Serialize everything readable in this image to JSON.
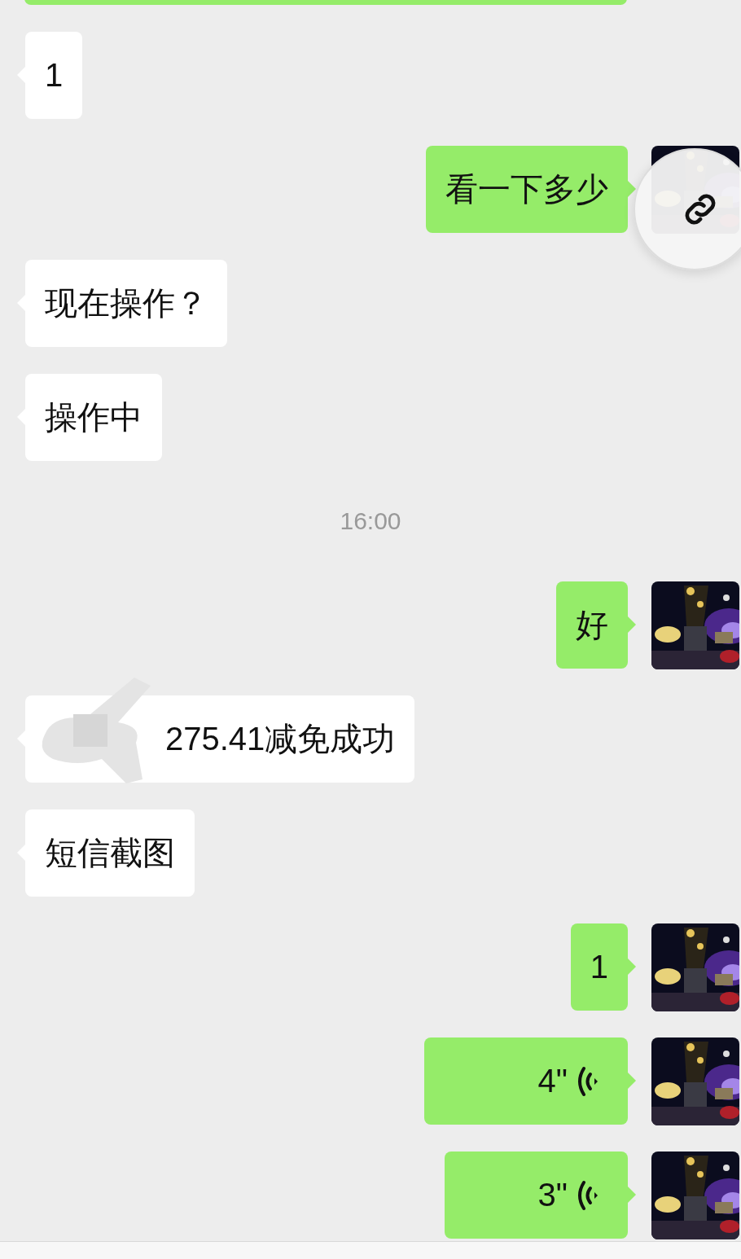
{
  "messages": [
    {
      "kind": "clipped"
    },
    {
      "kind": "text",
      "outgoing": false,
      "text": "1"
    },
    {
      "kind": "text",
      "outgoing": true,
      "text": "看一下多少",
      "link_button": true
    },
    {
      "kind": "text",
      "outgoing": false,
      "text": "现在操作？"
    },
    {
      "kind": "text",
      "outgoing": false,
      "text": "操作中"
    },
    {
      "kind": "time",
      "text": "16:00"
    },
    {
      "kind": "text",
      "outgoing": true,
      "text": "好"
    },
    {
      "kind": "text",
      "outgoing": false,
      "text": "275.41减免成功",
      "redacted": true
    },
    {
      "kind": "text",
      "outgoing": false,
      "text": "短信截图"
    },
    {
      "kind": "text",
      "outgoing": true,
      "text": "1"
    },
    {
      "kind": "voice",
      "outgoing": true,
      "text": "4\""
    },
    {
      "kind": "voice",
      "outgoing": true,
      "text": "3\""
    }
  ]
}
